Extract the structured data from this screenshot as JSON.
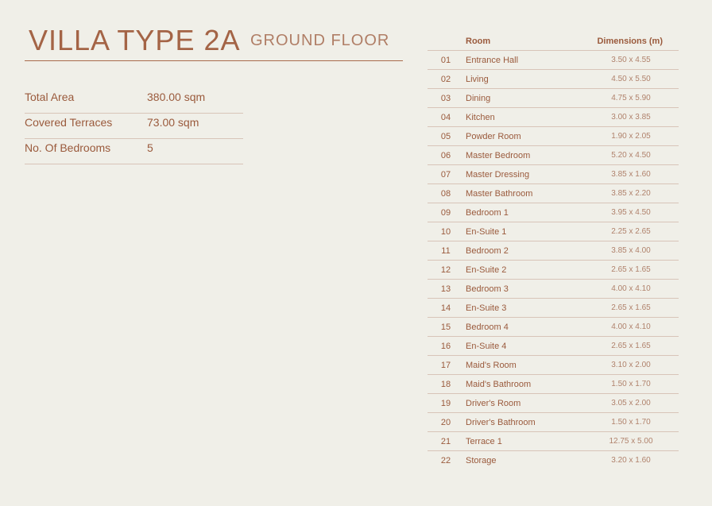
{
  "header": {
    "title": "VILLA TYPE 2A",
    "subtitle": "GROUND FLOOR"
  },
  "summary": [
    {
      "label": "Total Area",
      "value": "380.00 sqm"
    },
    {
      "label": "Covered Terraces",
      "value": "73.00 sqm"
    },
    {
      "label": "No. Of Bedrooms",
      "value": "5"
    }
  ],
  "rooms_table": {
    "col_room": "Room",
    "col_dimensions": "Dimensions (m)",
    "rows": [
      {
        "num": "01",
        "name": "Entrance Hall",
        "dim": "3.50 x 4.55"
      },
      {
        "num": "02",
        "name": "Living",
        "dim": "4.50 x 5.50"
      },
      {
        "num": "03",
        "name": "Dining",
        "dim": "4.75 x 5.90"
      },
      {
        "num": "04",
        "name": "Kitchen",
        "dim": "3.00 x 3.85"
      },
      {
        "num": "05",
        "name": "Powder Room",
        "dim": "1.90 x 2.05"
      },
      {
        "num": "06",
        "name": "Master Bedroom",
        "dim": "5.20 x 4.50"
      },
      {
        "num": "07",
        "name": "Master Dressing",
        "dim": "3.85 x 1.60"
      },
      {
        "num": "08",
        "name": "Master Bathroom",
        "dim": "3.85 x 2.20"
      },
      {
        "num": "09",
        "name": "Bedroom 1",
        "dim": "3.95 x 4.50"
      },
      {
        "num": "10",
        "name": "En-Suite 1",
        "dim": "2.25 x 2.65"
      },
      {
        "num": "11",
        "name": "Bedroom 2",
        "dim": "3.85 x 4.00"
      },
      {
        "num": "12",
        "name": "En-Suite  2",
        "dim": "2.65 x 1.65"
      },
      {
        "num": "13",
        "name": "Bedroom 3",
        "dim": "4.00 x 4.10"
      },
      {
        "num": "14",
        "name": "En-Suite  3",
        "dim": "2.65 x 1.65"
      },
      {
        "num": "15",
        "name": "Bedroom 4",
        "dim": "4.00 x 4.10"
      },
      {
        "num": "16",
        "name": "En-Suite  4",
        "dim": "2.65 x 1.65"
      },
      {
        "num": "17",
        "name": "Maid's Room",
        "dim": "3.10 x 2.00"
      },
      {
        "num": "18",
        "name": "Maid's Bathroom",
        "dim": "1.50 x 1.70"
      },
      {
        "num": "19",
        "name": "Driver's Room",
        "dim": "3.05 x 2.00"
      },
      {
        "num": "20",
        "name": "Driver's Bathroom",
        "dim": "1.50 x 1.70"
      },
      {
        "num": "21",
        "name": "Terrace 1",
        "dim": "12.75 x 5.00"
      },
      {
        "num": "22",
        "name": "Storage",
        "dim": "3.20 x 1.60"
      }
    ]
  },
  "colors": {
    "background": "#f0efe8",
    "accent": "#9a5a3c",
    "rule": "#d8c4b8"
  }
}
